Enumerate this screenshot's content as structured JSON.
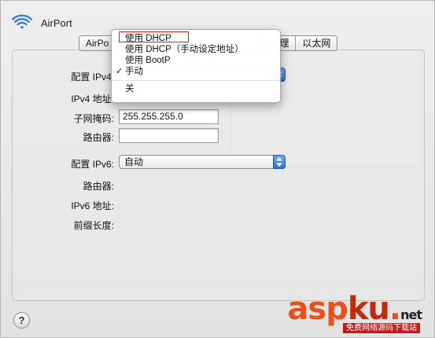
{
  "header": {
    "title": "AirPort"
  },
  "tabs": [
    "AirPo",
    "代理",
    "以太网"
  ],
  "ipv4": {
    "config_label": "配置 IPv4:",
    "address_label": "IPv4 地址:",
    "subnet_label": "子网掩码:",
    "subnet_value": "255.255.255.0",
    "router_label": "路由器:",
    "router_value": ""
  },
  "ipv6": {
    "config_label": "配置 IPv6:",
    "config_value": "自动",
    "router_label": "路由器:",
    "address_label": "IPv6 地址:",
    "prefix_label": "前缀长度:"
  },
  "menu": {
    "items": [
      "使用 DHCP",
      "使用 DHCP（手动设定地址）",
      "使用 BootP",
      "手动"
    ],
    "checked_item": "手动",
    "off_item": "关",
    "highlight_color": "#d22020"
  },
  "help_button": "?",
  "watermark": {
    "asp": "asp",
    "ku": "ku",
    "dot": ".",
    "net": "net",
    "sub": "免费网络源码下载站"
  },
  "icons": {
    "wifi": "wifi-icon",
    "help": "question-mark",
    "popup": "up-down-arrows-icon"
  }
}
